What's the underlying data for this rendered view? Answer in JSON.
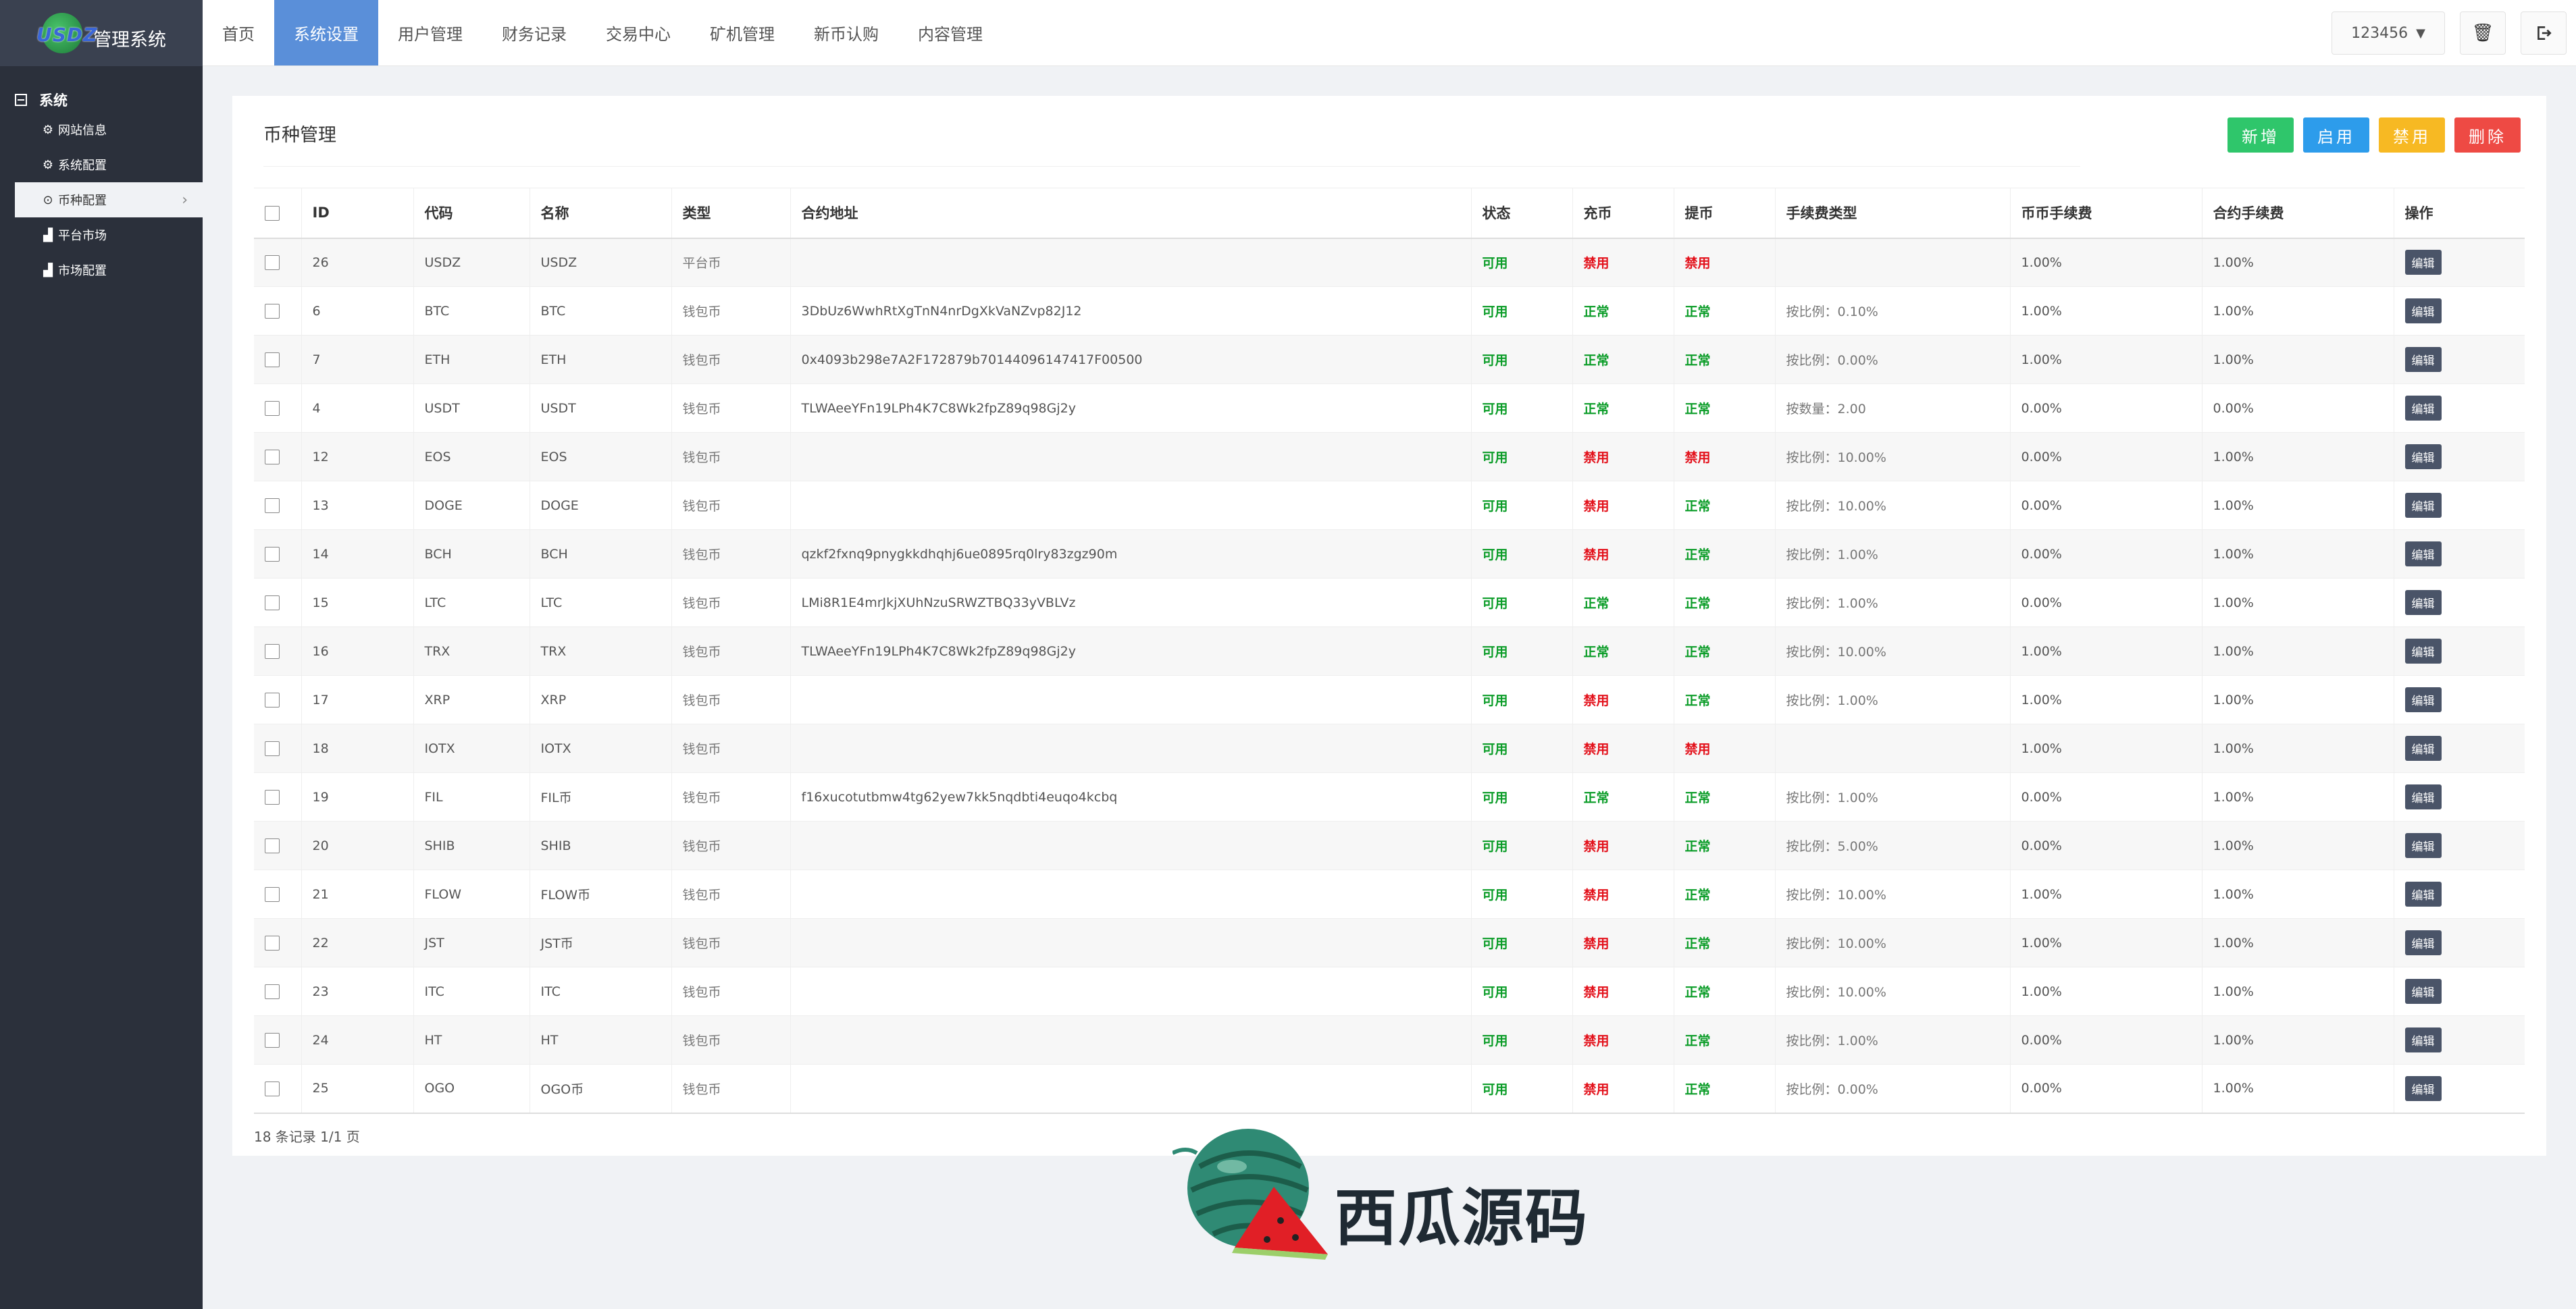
{
  "app": {
    "logo_text": "USDZ",
    "title": "管理系统"
  },
  "sidebar": {
    "group_label": "系统",
    "items": [
      {
        "label": "网站信息",
        "icon": "gear-icon"
      },
      {
        "label": "系统配置",
        "icon": "gear-icon"
      },
      {
        "label": "币种配置",
        "icon": "circle-icon",
        "active": true
      },
      {
        "label": "平台市场",
        "icon": "bar-chart-icon"
      },
      {
        "label": "市场配置",
        "icon": "bar-chart-icon"
      }
    ]
  },
  "nav": {
    "items": [
      {
        "label": "首页"
      },
      {
        "label": "系统设置",
        "active": true
      },
      {
        "label": "用户管理"
      },
      {
        "label": "财务记录"
      },
      {
        "label": "交易中心"
      },
      {
        "label": "矿机管理"
      },
      {
        "label": "新币认购"
      },
      {
        "label": "内容管理"
      }
    ],
    "user": "123456"
  },
  "panel": {
    "title": "币种管理",
    "actions": {
      "add": "新增",
      "enable": "启用",
      "disable": "禁用",
      "delete": "删除"
    },
    "columns": [
      "ID",
      "代码",
      "名称",
      "类型",
      "合约地址",
      "状态",
      "充币",
      "提币",
      "手续费类型",
      "币币手续费",
      "合约手续费",
      "操作"
    ],
    "edit_label": "编辑",
    "rows": [
      {
        "id": "26",
        "code": "USDZ",
        "name": "USDZ",
        "type": "平台币",
        "address": "",
        "status": "可用",
        "deposit": "禁用",
        "withdraw": "禁用",
        "fee_type": "",
        "spot_fee": "1.00%",
        "contract_fee": "1.00%"
      },
      {
        "id": "6",
        "code": "BTC",
        "name": "BTC",
        "type": "钱包币",
        "address": "3DbUz6WwhRtXgTnN4nrDgXkVaNZvp82J12",
        "status": "可用",
        "deposit": "正常",
        "withdraw": "正常",
        "fee_type": "按比例：0.10%",
        "spot_fee": "1.00%",
        "contract_fee": "1.00%"
      },
      {
        "id": "7",
        "code": "ETH",
        "name": "ETH",
        "type": "钱包币",
        "address": "0x4093b298e7A2F172879b70144096147417F00500",
        "status": "可用",
        "deposit": "正常",
        "withdraw": "正常",
        "fee_type": "按比例：0.00%",
        "spot_fee": "1.00%",
        "contract_fee": "1.00%"
      },
      {
        "id": "4",
        "code": "USDT",
        "name": "USDT",
        "type": "钱包币",
        "address": "TLWAeeYFn19LPh4K7C8Wk2fpZ89q98Gj2y",
        "status": "可用",
        "deposit": "正常",
        "withdraw": "正常",
        "fee_type": "按数量：2.00",
        "spot_fee": "0.00%",
        "contract_fee": "0.00%"
      },
      {
        "id": "12",
        "code": "EOS",
        "name": "EOS",
        "type": "钱包币",
        "address": "",
        "status": "可用",
        "deposit": "禁用",
        "withdraw": "禁用",
        "fee_type": "按比例：10.00%",
        "spot_fee": "0.00%",
        "contract_fee": "1.00%"
      },
      {
        "id": "13",
        "code": "DOGE",
        "name": "DOGE",
        "type": "钱包币",
        "address": "",
        "status": "可用",
        "deposit": "禁用",
        "withdraw": "正常",
        "fee_type": "按比例：10.00%",
        "spot_fee": "0.00%",
        "contract_fee": "1.00%"
      },
      {
        "id": "14",
        "code": "BCH",
        "name": "BCH",
        "type": "钱包币",
        "address": "qzkf2fxnq9pnygkkdhqhj6ue0895rq0lry83zgz90m",
        "status": "可用",
        "deposit": "禁用",
        "withdraw": "正常",
        "fee_type": "按比例：1.00%",
        "spot_fee": "0.00%",
        "contract_fee": "1.00%"
      },
      {
        "id": "15",
        "code": "LTC",
        "name": "LTC",
        "type": "钱包币",
        "address": "LMi8R1E4mrJkjXUhNzuSRWZTBQ33yVBLVz",
        "status": "可用",
        "deposit": "正常",
        "withdraw": "正常",
        "fee_type": "按比例：1.00%",
        "spot_fee": "0.00%",
        "contract_fee": "1.00%"
      },
      {
        "id": "16",
        "code": "TRX",
        "name": "TRX",
        "type": "钱包币",
        "address": "TLWAeeYFn19LPh4K7C8Wk2fpZ89q98Gj2y",
        "status": "可用",
        "deposit": "正常",
        "withdraw": "正常",
        "fee_type": "按比例：10.00%",
        "spot_fee": "1.00%",
        "contract_fee": "1.00%"
      },
      {
        "id": "17",
        "code": "XRP",
        "name": "XRP",
        "type": "钱包币",
        "address": "",
        "status": "可用",
        "deposit": "禁用",
        "withdraw": "正常",
        "fee_type": "按比例：1.00%",
        "spot_fee": "1.00%",
        "contract_fee": "1.00%"
      },
      {
        "id": "18",
        "code": "IOTX",
        "name": "IOTX",
        "type": "钱包币",
        "address": "",
        "status": "可用",
        "deposit": "禁用",
        "withdraw": "禁用",
        "fee_type": "",
        "spot_fee": "1.00%",
        "contract_fee": "1.00%"
      },
      {
        "id": "19",
        "code": "FIL",
        "name": "FIL币",
        "type": "钱包币",
        "address": "f16xucotutbmw4tg62yew7kk5nqdbti4euqo4kcbq",
        "status": "可用",
        "deposit": "正常",
        "withdraw": "正常",
        "fee_type": "按比例：1.00%",
        "spot_fee": "0.00%",
        "contract_fee": "1.00%"
      },
      {
        "id": "20",
        "code": "SHIB",
        "name": "SHIB",
        "type": "钱包币",
        "address": "",
        "status": "可用",
        "deposit": "禁用",
        "withdraw": "正常",
        "fee_type": "按比例：5.00%",
        "spot_fee": "0.00%",
        "contract_fee": "1.00%"
      },
      {
        "id": "21",
        "code": "FLOW",
        "name": "FLOW币",
        "type": "钱包币",
        "address": "",
        "status": "可用",
        "deposit": "禁用",
        "withdraw": "正常",
        "fee_type": "按比例：10.00%",
        "spot_fee": "1.00%",
        "contract_fee": "1.00%"
      },
      {
        "id": "22",
        "code": "JST",
        "name": "JST币",
        "type": "钱包币",
        "address": "",
        "status": "可用",
        "deposit": "禁用",
        "withdraw": "正常",
        "fee_type": "按比例：10.00%",
        "spot_fee": "1.00%",
        "contract_fee": "1.00%"
      },
      {
        "id": "23",
        "code": "ITC",
        "name": "ITC",
        "type": "钱包币",
        "address": "",
        "status": "可用",
        "deposit": "禁用",
        "withdraw": "正常",
        "fee_type": "按比例：10.00%",
        "spot_fee": "1.00%",
        "contract_fee": "1.00%"
      },
      {
        "id": "24",
        "code": "HT",
        "name": "HT",
        "type": "钱包币",
        "address": "",
        "status": "可用",
        "deposit": "禁用",
        "withdraw": "正常",
        "fee_type": "按比例：1.00%",
        "spot_fee": "0.00%",
        "contract_fee": "1.00%"
      },
      {
        "id": "25",
        "code": "OGO",
        "name": "OGO币",
        "type": "钱包币",
        "address": "",
        "status": "可用",
        "deposit": "禁用",
        "withdraw": "正常",
        "fee_type": "按比例：0.00%",
        "spot_fee": "0.00%",
        "contract_fee": "1.00%"
      }
    ],
    "footer": "18 条记录 1/1 页"
  },
  "watermark": {
    "text": "西瓜源码"
  },
  "colors": {
    "ok": "#0a9c27",
    "no": "#e3111b",
    "nav_active": "#5a8fd9",
    "sidebar": "#2b303b"
  }
}
